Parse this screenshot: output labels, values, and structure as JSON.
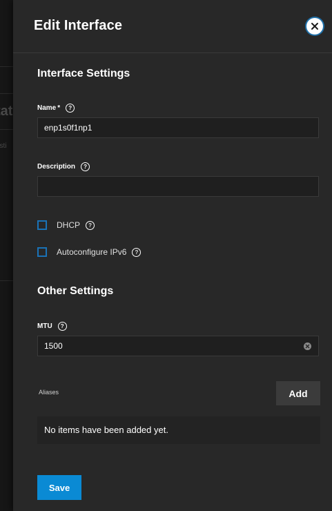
{
  "background": {
    "fragment_heading": "tat",
    "fragment_text": "esti"
  },
  "dialog": {
    "title": "Edit Interface",
    "close_icon": "close-icon"
  },
  "interface_settings": {
    "section_title": "Interface Settings",
    "name_label": "Name",
    "name_required_mark": "*",
    "name_value": "enp1s0f1np1",
    "description_label": "Description",
    "description_value": "",
    "dhcp_label": "DHCP",
    "dhcp_checked": false,
    "autoconfigure_label": "Autoconfigure IPv6",
    "autoconfigure_checked": false
  },
  "other_settings": {
    "section_title": "Other Settings",
    "mtu_label": "MTU",
    "mtu_value": "1500"
  },
  "aliases": {
    "label": "Aliases",
    "add_button": "Add",
    "empty_text": "No items have been added yet."
  },
  "footer": {
    "save_button": "Save"
  },
  "colors": {
    "primary": "#0a8ad4",
    "checkbox_border": "#1a73b8",
    "panel": "#282828"
  }
}
